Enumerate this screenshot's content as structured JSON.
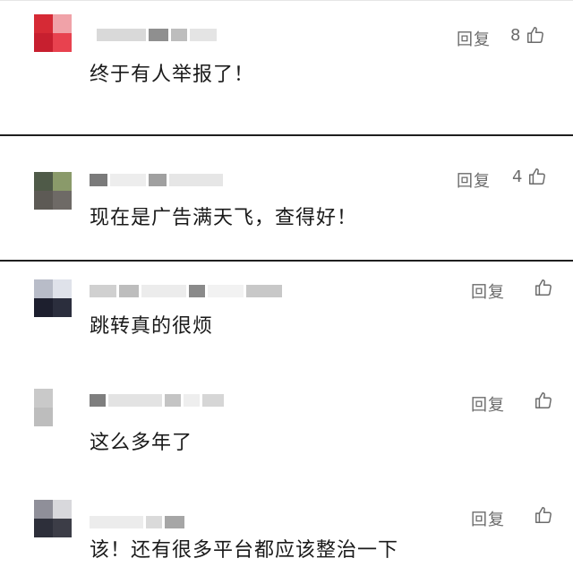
{
  "comments": [
    {
      "text": "终于有人举报了！",
      "reply_label": "回复",
      "likes": "8",
      "avatar_colors": [
        "#d62a35",
        "#f0a2a8",
        "#c71f2f",
        "#e8424f"
      ]
    },
    {
      "text": "现在是广告满天飞，查得好！",
      "reply_label": "回复",
      "likes": "4",
      "avatar_colors": [
        "#4f5a48",
        "#8a9a6a",
        "#5d5a55",
        "#6e6a66"
      ]
    },
    {
      "text": "跳转真的很烦",
      "reply_label": "回复",
      "likes": "",
      "avatar_colors": [
        "#b8bcc8",
        "#dfe2ea",
        "#1d1f2e",
        "#2b2e3d"
      ]
    },
    {
      "text": "这么多年了",
      "reply_label": "回复",
      "likes": "",
      "avatar_colors": [
        "#c9c9c9",
        "#ffffff",
        "#bdbdbd",
        "#ffffff"
      ]
    },
    {
      "text": "该！还有很多平台都应该整治一下",
      "reply_label": "回复",
      "likes": "",
      "avatar_colors": [
        "#8f8f99",
        "#d8d8dc",
        "#2d2f3a",
        "#3c3d47"
      ]
    }
  ],
  "colors": {
    "text": "#1a1a1a",
    "meta": "#6b6b6b",
    "divider": "#1f1f1f"
  },
  "icons": {
    "like": "thumbs-up-icon"
  }
}
